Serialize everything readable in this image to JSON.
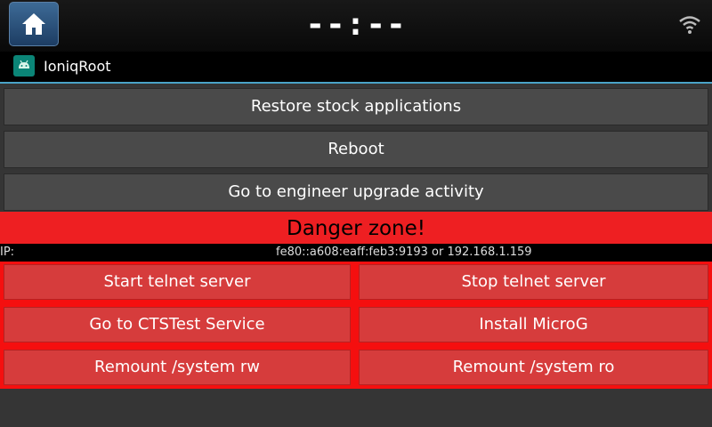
{
  "statusbar": {
    "clock": "--:--",
    "home_icon": "home-icon",
    "wifi_icon": "wifi-icon"
  },
  "appbar": {
    "icon": "android-icon",
    "title": "IoniqRoot"
  },
  "buttons": {
    "restore": "Restore stock applications",
    "reboot": "Reboot",
    "engineer": "Go to engineer upgrade activity"
  },
  "danger": {
    "title": "Danger zone!",
    "ip_label": "IP:",
    "ip_value": "fe80::a608:eaff:feb3:9193 or 192.168.1.159",
    "start_telnet": "Start telnet server",
    "stop_telnet": "Stop telnet server",
    "ctstest": "Go to CTSTest Service",
    "microg": "Install MicroG",
    "remount_rw": "Remount /system rw",
    "remount_ro": "Remount /system ro"
  },
  "colors": {
    "danger_red": "#f50f0f",
    "button_red": "#d63c3c",
    "button_gray": "#4a4a4a",
    "accent_blue": "#4aa3c8"
  }
}
